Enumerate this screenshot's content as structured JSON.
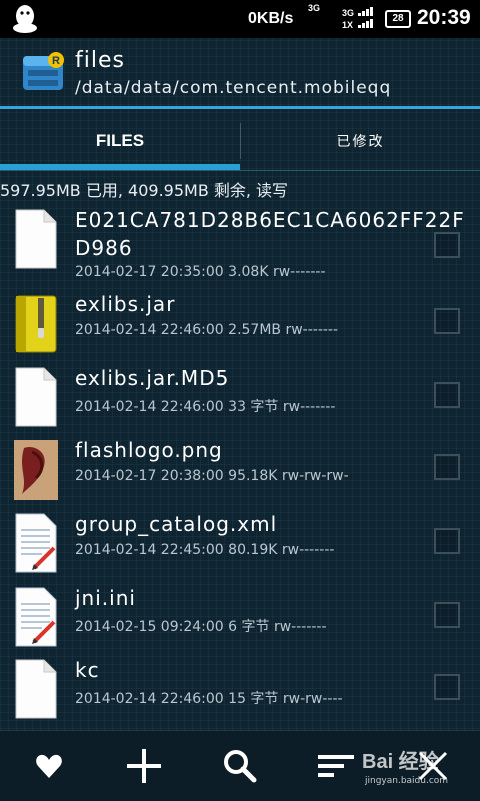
{
  "status_bar": {
    "net_speed": "0KB/s",
    "net_type": "3G",
    "signal_label": "3G",
    "signal_sub": "1X",
    "battery": "28",
    "time": "20:39"
  },
  "header": {
    "title": "files",
    "path": "/data/data/com.tencent.mobileqq",
    "app_icon_letter": "R"
  },
  "tabs": {
    "files": "FILES",
    "modified": "已修改"
  },
  "storage_info": "597.95MB 已用, 409.95MB 剩余, 读写",
  "files": [
    {
      "name": "E021CA781D28B6EC1CA6062FF22FD986",
      "date": "2014-02-17 20:35:00",
      "size": "3.08K",
      "perm": "rw-------",
      "icon": "blank-file-icon"
    },
    {
      "name": "exlibs.jar",
      "date": "2014-02-14 22:46:00",
      "size": "2.57MB",
      "perm": "rw-------",
      "icon": "archive-file-icon"
    },
    {
      "name": "exlibs.jar.MD5",
      "date": "2014-02-14 22:46:00",
      "size": "33 字节",
      "perm": "rw-------",
      "icon": "blank-file-icon"
    },
    {
      "name": "flashlogo.png",
      "date": "2014-02-17 20:38:00",
      "size": "95.18K",
      "perm": "rw-rw-rw-",
      "icon": "image-thumbnail-icon"
    },
    {
      "name": "group_catalog.xml",
      "date": "2014-02-14 22:45:00",
      "size": "80.19K",
      "perm": "rw-------",
      "icon": "text-document-icon"
    },
    {
      "name": "jni.ini",
      "date": "2014-02-15 09:24:00",
      "size": "6 字节",
      "perm": "rw-------",
      "icon": "text-document-icon"
    },
    {
      "name": "kc",
      "date": "2014-02-14 22:46:00",
      "size": "15 字节",
      "perm": "rw-rw----",
      "icon": "blank-file-icon"
    }
  ],
  "bottom_bar": {
    "buttons": [
      "favorites-icon",
      "add-icon",
      "search-icon",
      "sort-icon",
      "close-icon"
    ]
  },
  "watermark": {
    "brand": "Bai 经验",
    "url": "jingyan.baidu.com"
  },
  "colors": {
    "accent": "#2a9fd6",
    "background": "#0f2431",
    "meta_text": "#b9c7cf"
  }
}
